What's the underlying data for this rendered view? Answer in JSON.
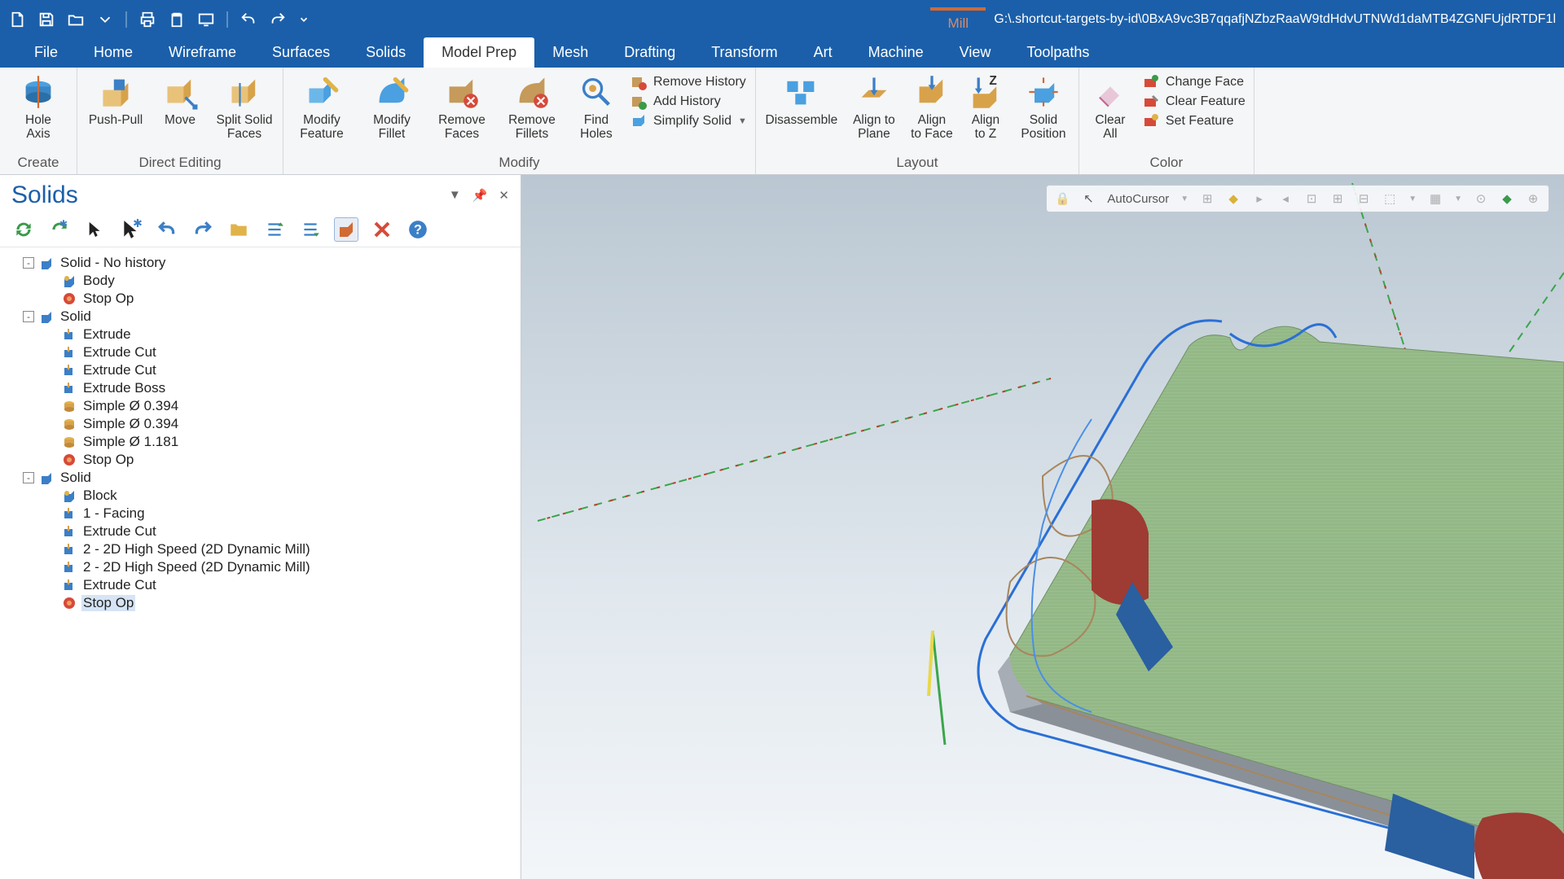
{
  "title": {
    "context_tab": "Mill",
    "path": "G:\\.shortcut-targets-by-id\\0BxA9vc3B7qqafjNZbzRaaW9tdHdvUTNWd1daMTB4ZGNFUjdRTDF1l"
  },
  "menu": {
    "tabs": [
      "File",
      "Home",
      "Wireframe",
      "Surfaces",
      "Solids",
      "Model Prep",
      "Mesh",
      "Drafting",
      "Transform",
      "Art",
      "Machine",
      "View",
      "Toolpaths"
    ],
    "active": "Model Prep"
  },
  "ribbon": {
    "create": {
      "label": "Create",
      "hole_axis": "Hole\nAxis"
    },
    "direct": {
      "label": "Direct Editing",
      "push_pull": "Push-Pull",
      "move": "Move",
      "split": "Split Solid\nFaces"
    },
    "modify": {
      "label": "Modify",
      "modify_feature": "Modify\nFeature",
      "modify_fillet": "Modify\nFillet",
      "remove_faces": "Remove\nFaces",
      "remove_fillets": "Remove\nFillets",
      "find_holes": "Find\nHoles",
      "remove_history": "Remove History",
      "add_history": "Add History",
      "simplify_solid": "Simplify Solid"
    },
    "layout": {
      "label": "Layout",
      "disassemble": "Disassemble",
      "align_plane": "Align to\nPlane",
      "align_face": "Align\nto Face",
      "align_z": "Align\nto Z",
      "solid_pos": "Solid\nPosition"
    },
    "color": {
      "label": "Color",
      "clear_all": "Clear\nAll",
      "change_face": "Change Face",
      "clear_feature": "Clear Feature",
      "set_feature": "Set Feature"
    }
  },
  "panel": {
    "title": "Solids",
    "tree": [
      {
        "d": 0,
        "pm": "-",
        "icon": "solid",
        "label": "Solid - No history"
      },
      {
        "d": 1,
        "icon": "body",
        "label": "Body"
      },
      {
        "d": 1,
        "icon": "stop",
        "label": "Stop Op"
      },
      {
        "d": 0,
        "pm": "-",
        "icon": "solid",
        "label": "Solid"
      },
      {
        "d": 1,
        "icon": "feat",
        "label": "Extrude"
      },
      {
        "d": 1,
        "icon": "feat",
        "label": "Extrude Cut"
      },
      {
        "d": 1,
        "icon": "feat",
        "label": "Extrude Cut"
      },
      {
        "d": 1,
        "icon": "feat",
        "label": "Extrude Boss"
      },
      {
        "d": 1,
        "icon": "hole",
        "label": "Simple Ø 0.394"
      },
      {
        "d": 1,
        "icon": "hole",
        "label": "Simple Ø 0.394"
      },
      {
        "d": 1,
        "icon": "hole",
        "label": "Simple Ø 1.181"
      },
      {
        "d": 1,
        "icon": "stop",
        "label": "Stop Op"
      },
      {
        "d": 0,
        "pm": "-",
        "icon": "solid",
        "label": "Solid"
      },
      {
        "d": 1,
        "icon": "body",
        "label": "Block"
      },
      {
        "d": 1,
        "icon": "feat",
        "label": "1 - Facing"
      },
      {
        "d": 1,
        "icon": "feat",
        "label": "Extrude Cut"
      },
      {
        "d": 1,
        "icon": "feat",
        "label": "2 - 2D High Speed (2D Dynamic Mill)"
      },
      {
        "d": 1,
        "icon": "feat",
        "label": "2 - 2D High Speed (2D Dynamic Mill)"
      },
      {
        "d": 1,
        "icon": "feat",
        "label": "Extrude Cut"
      },
      {
        "d": 1,
        "icon": "stop",
        "label": "Stop Op",
        "sel": true
      }
    ]
  },
  "viewport": {
    "autocursor": "AutoCursor"
  }
}
